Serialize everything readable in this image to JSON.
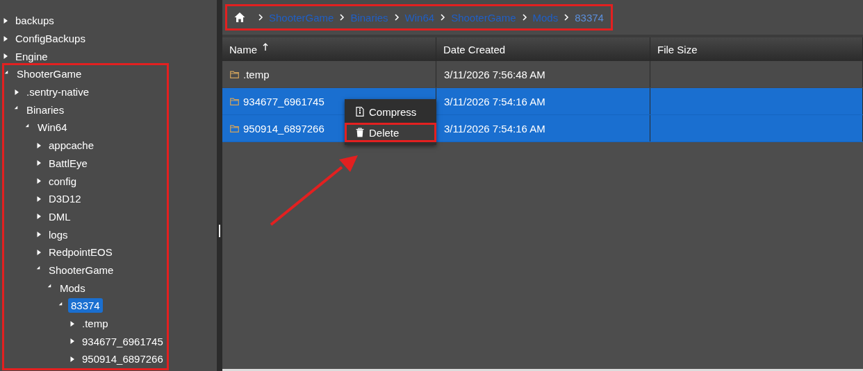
{
  "tree": {
    "items": [
      {
        "label": "backups",
        "expanded": false,
        "selected": false
      },
      {
        "label": "ConfigBackups",
        "expanded": false,
        "selected": false
      },
      {
        "label": "Engine",
        "expanded": false,
        "selected": false
      },
      {
        "label": "ShooterGame",
        "expanded": true,
        "selected": false,
        "highlighted": true,
        "children": [
          {
            "label": ".sentry-native",
            "expanded": false,
            "selected": false
          },
          {
            "label": "Binaries",
            "expanded": true,
            "selected": false,
            "children": [
              {
                "label": "Win64",
                "expanded": true,
                "selected": false,
                "children": [
                  {
                    "label": "appcache",
                    "expanded": false,
                    "selected": false
                  },
                  {
                    "label": "BattlEye",
                    "expanded": false,
                    "selected": false
                  },
                  {
                    "label": "config",
                    "expanded": false,
                    "selected": false
                  },
                  {
                    "label": "D3D12",
                    "expanded": false,
                    "selected": false
                  },
                  {
                    "label": "DML",
                    "expanded": false,
                    "selected": false
                  },
                  {
                    "label": "logs",
                    "expanded": false,
                    "selected": false
                  },
                  {
                    "label": "RedpointEOS",
                    "expanded": false,
                    "selected": false
                  },
                  {
                    "label": "ShooterGame",
                    "expanded": true,
                    "selected": false,
                    "children": [
                      {
                        "label": "Mods",
                        "expanded": true,
                        "selected": false,
                        "children": [
                          {
                            "label": "83374",
                            "expanded": true,
                            "selected": true,
                            "children": [
                              {
                                "label": ".temp",
                                "expanded": false,
                                "selected": false
                              },
                              {
                                "label": "934677_6961745",
                                "expanded": false,
                                "selected": false
                              },
                              {
                                "label": "950914_6897266",
                                "expanded": false,
                                "selected": false
                              }
                            ]
                          }
                        ]
                      }
                    ]
                  }
                ]
              }
            ]
          }
        ]
      }
    ]
  },
  "breadcrumb": {
    "highlighted": true,
    "items": [
      {
        "label": "ShooterGame",
        "current": false
      },
      {
        "label": "Binaries",
        "current": false
      },
      {
        "label": "Win64",
        "current": false
      },
      {
        "label": "ShooterGame",
        "current": false
      },
      {
        "label": "Mods",
        "current": false
      },
      {
        "label": "83374",
        "current": true
      }
    ]
  },
  "table": {
    "columns": [
      {
        "label": "Name",
        "sorted": true
      },
      {
        "label": "Date Created",
        "sorted": false
      },
      {
        "label": "File Size",
        "sorted": false
      }
    ],
    "rows": [
      {
        "name": ".temp",
        "date_created": "3/11/2026 7:56:48 AM",
        "selected": false
      },
      {
        "name": "934677_6961745",
        "date_created": "3/11/2026 7:54:16 AM",
        "selected": true
      },
      {
        "name": "950914_6897266",
        "date_created": "3/11/2026 7:54:16 AM",
        "selected": true
      }
    ]
  },
  "context_menu": {
    "items": [
      {
        "label": "Compress",
        "kind": "compress",
        "highlighted": false
      },
      {
        "label": "Delete",
        "kind": "delete",
        "highlighted": true
      }
    ]
  },
  "arrow": {
    "kind": "arrow"
  }
}
